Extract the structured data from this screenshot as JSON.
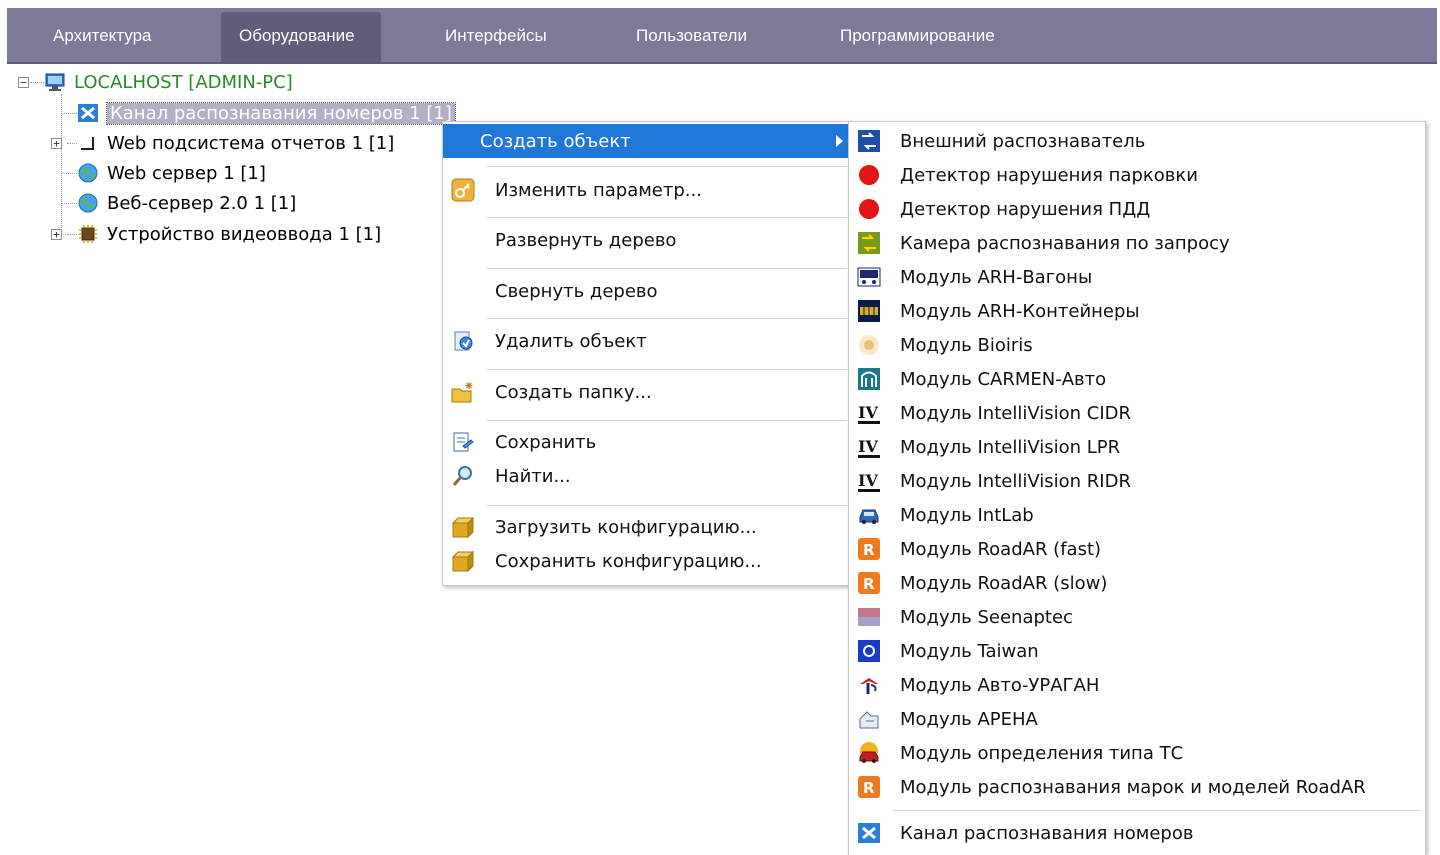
{
  "tabs": [
    {
      "label": "Архитектура",
      "active": false
    },
    {
      "label": "Оборудование",
      "active": true
    },
    {
      "label": "Интерфейсы",
      "active": false
    },
    {
      "label": "Пользователи",
      "active": false
    },
    {
      "label": "Программирование",
      "active": false
    }
  ],
  "tree": {
    "root": {
      "label": "LOCALHOST [ADMIN-PC]",
      "icon": "computer-icon"
    },
    "children": [
      {
        "label": "Канал распознавания номеров 1 [1]",
        "icon": "plate-channel-icon",
        "selected": true
      },
      {
        "label": "Web подсистема отчетов 1 [1]",
        "icon": "report-icon"
      },
      {
        "label": "Web сервер 1 [1]",
        "icon": "globe-icon"
      },
      {
        "label": "Веб-сервер 2.0 1 [1]",
        "icon": "globe-icon"
      },
      {
        "label": "Устройство видеоввода 1 [1]",
        "icon": "chip-icon"
      }
    ]
  },
  "context_menu": {
    "items": [
      {
        "label": "Создать объект",
        "highlighted": true,
        "has_submenu": true
      },
      {
        "label": "Изменить параметр...",
        "icon": "key-icon"
      },
      {
        "label": "Развернуть дерево"
      },
      {
        "label": "Свернуть дерево"
      },
      {
        "label": "Удалить объект",
        "icon": "delete-icon"
      },
      {
        "label": "Создать папку...",
        "icon": "new-folder-icon"
      },
      {
        "label": "Сохранить",
        "icon": "save-icon"
      },
      {
        "label": "Найти...",
        "icon": "search-icon"
      },
      {
        "label": "Загрузить конфигурацию...",
        "icon": "load-config-icon"
      },
      {
        "label": "Сохранить конфигурацию...",
        "icon": "save-config-icon"
      }
    ]
  },
  "submenu": {
    "items": [
      {
        "label": "Внешний распознаватель",
        "icon": "external-recognizer-icon"
      },
      {
        "label": "Детектор нарушения парковки",
        "icon": "red-dot-icon"
      },
      {
        "label": "Детектор нарушения ПДД",
        "icon": "red-dot-icon"
      },
      {
        "label": "Камера распознавания по запросу",
        "icon": "on-demand-camera-icon"
      },
      {
        "label": "Модуль ARH-Вагоны",
        "icon": "arh-wagons-icon"
      },
      {
        "label": "Модуль ARH-Контейнеры",
        "icon": "arh-containers-icon"
      },
      {
        "label": "Модуль Bioiris",
        "icon": "bioiris-icon"
      },
      {
        "label": "Модуль CARMEN-Авто",
        "icon": "carmen-icon"
      },
      {
        "label": "Модуль IntelliVision CIDR",
        "icon": "intellivision-icon"
      },
      {
        "label": "Модуль IntelliVision LPR",
        "icon": "intellivision-icon"
      },
      {
        "label": "Модуль IntelliVision RIDR",
        "icon": "intellivision-icon"
      },
      {
        "label": "Модуль IntLab",
        "icon": "car-icon"
      },
      {
        "label": "Модуль RoadAR (fast)",
        "icon": "roadar-icon"
      },
      {
        "label": "Модуль RoadAR (slow)",
        "icon": "roadar-icon"
      },
      {
        "label": "Модуль Seenaptec",
        "icon": "seenaptec-icon"
      },
      {
        "label": "Модуль Taiwan",
        "icon": "taiwan-icon"
      },
      {
        "label": "Модуль Авто-УРАГАН",
        "icon": "uragan-icon"
      },
      {
        "label": "Модуль АРЕНА",
        "icon": "arena-icon"
      },
      {
        "label": "Модуль определения типа ТС",
        "icon": "vehicle-type-icon"
      },
      {
        "label": "Модуль распознавания марок и моделей RoadAR",
        "icon": "roadar-icon"
      },
      {
        "label": "Канал распознавания номеров",
        "icon": "plate-channel-icon"
      }
    ]
  },
  "colors": {
    "tabbar": "#7c7a99",
    "tab_active": "#5f5d7c",
    "menu_highlight": "#1f78d7",
    "tree_root": "#2a8a2a",
    "tree_selected": "#b3b1c6"
  }
}
